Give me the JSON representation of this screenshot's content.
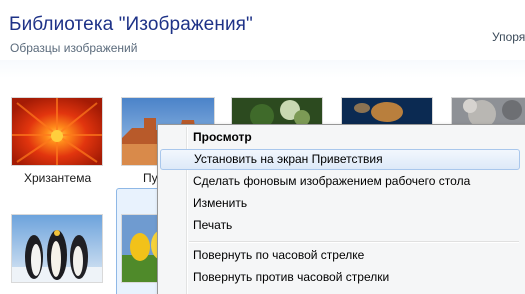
{
  "library": {
    "title": "Библиотека \"Изображения\"",
    "subtitle": "Образцы изображений",
    "arrange_label": "Упоря"
  },
  "thumbnails": [
    {
      "name": "Хризантема",
      "icon": "chrysanthemum-thumbnail",
      "label_visible": true
    },
    {
      "name": "Пу",
      "icon": "desert-thumbnail",
      "label_visible": true
    },
    {
      "name": "",
      "icon": "hydrangeas-thumbnail",
      "label_visible": false
    },
    {
      "name": "",
      "icon": "jellyfish-thumbnail",
      "label_visible": false
    },
    {
      "name": "",
      "icon": "koala-thumbnail",
      "label_visible": false
    },
    {
      "name": "",
      "icon": "penguins-thumbnail",
      "label_visible": false
    },
    {
      "name": "",
      "icon": "tulips-thumbnail",
      "label_visible": false
    }
  ],
  "context_menu": {
    "items": [
      {
        "label": "Просмотр",
        "bold": true
      },
      {
        "label": "Установить на экран Приветствия",
        "highlighted": true
      },
      {
        "label": "Сделать фоновым изображением рабочего стола"
      },
      {
        "label": "Изменить"
      },
      {
        "label": "Печать"
      },
      {
        "label": "Повернуть по часовой стрелке"
      },
      {
        "label": "Повернуть против часовой стрелки"
      }
    ]
  },
  "colors": {
    "title": "#1e3287",
    "highlight_border": "#a9c7ec",
    "selection_fill": "#e8f2fd"
  }
}
